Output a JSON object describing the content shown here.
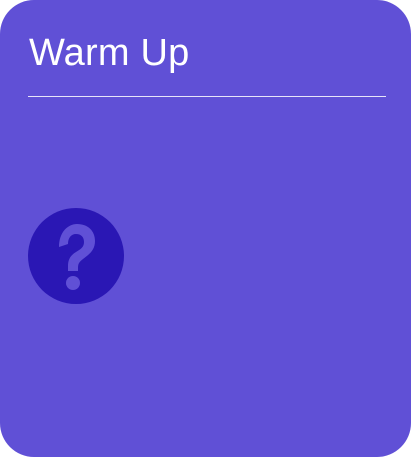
{
  "card": {
    "title": "Warm Up",
    "icon": "help-circle-icon"
  },
  "colors": {
    "card_background": "#6050d6",
    "icon_circle": "#2a17b4",
    "icon_glyph": "#6050d6",
    "text": "#ffffff"
  }
}
